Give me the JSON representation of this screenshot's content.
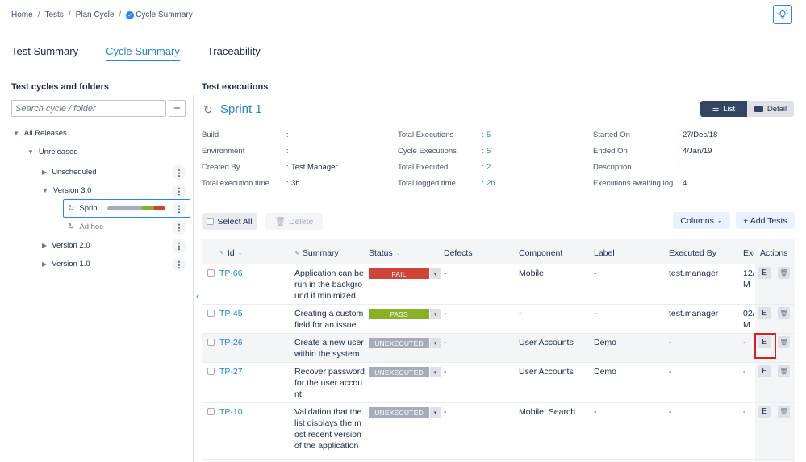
{
  "breadcrumb": [
    "Home",
    "Tests",
    "Plan Cycle",
    "Cycle Summary"
  ],
  "tabs": [
    "Test Summary",
    "Cycle Summary",
    "Traceability"
  ],
  "left": {
    "title": "Test cycles and folders",
    "search_placeholder": "Search cycle / folder",
    "tree": {
      "all_releases": "All Releases",
      "unreleased": "Unreleased",
      "unscheduled": "Unscheduled",
      "version30": "Version 3.0",
      "sprint": "Sprin...",
      "adhoc": "Ad hoc",
      "version20": "Version 2.0",
      "version10": "Version 1.0"
    },
    "progress": {
      "unexecuted": 0.6,
      "pass": 0.2,
      "fail": 0.2
    },
    "colors": {
      "pass": "#8bb026",
      "fail": "#d04437",
      "unexecuted": "#a5adba"
    }
  },
  "right": {
    "title": "Test executions",
    "cycle_name": "Sprint 1",
    "view_list": "List",
    "view_detail": "Detail",
    "meta": {
      "col1": [
        {
          "k": "Build",
          "v": ""
        },
        {
          "k": "Environment",
          "v": ""
        },
        {
          "k": "Created By",
          "v": "Test Manager"
        },
        {
          "k": "Total execution time",
          "v": "3h"
        }
      ],
      "col2": [
        {
          "k": "Total Executions",
          "v": "5"
        },
        {
          "k": "Cycle Executions",
          "v": "5"
        },
        {
          "k": "Total Executed",
          "v": "2"
        },
        {
          "k": "Total logged time",
          "v": "2h"
        }
      ],
      "col3": [
        {
          "k": "Started On",
          "v": "27/Dec/18"
        },
        {
          "k": "Ended On",
          "v": "4/Jan/19"
        },
        {
          "k": "Description",
          "v": ""
        },
        {
          "k": "Executions awaiting log",
          "v": "4"
        }
      ]
    },
    "toolbar": {
      "select_all": "Select All",
      "delete": "Delete",
      "columns": "Columns",
      "add_tests": "+ Add Tests"
    },
    "columns": [
      "Id",
      "Summary",
      "Status",
      "Defects",
      "Component",
      "Label",
      "Executed By",
      "Exe",
      "Actions"
    ],
    "rows": [
      {
        "id": "TP-66",
        "summary": [
          "Application can be",
          "run in the backgro",
          "und if minimized"
        ],
        "status": "FAIL",
        "status_color": "#d04437",
        "defects": "-",
        "component": "Mobile",
        "label": "-",
        "executed_by": "test.manager",
        "exe": [
          "12/",
          "M"
        ]
      },
      {
        "id": "TP-45",
        "summary": [
          "Creating a custom",
          "field for an issue"
        ],
        "status": "PASS",
        "status_color": "#8bb026",
        "defects": "-",
        "component": "-",
        "label": "-",
        "executed_by": "test.manager",
        "exe": [
          "02/",
          "M"
        ]
      },
      {
        "id": "TP-26",
        "summary": [
          "Create a new user",
          "within the system"
        ],
        "status": "UNEXECUTED",
        "status_color": "#a5adba",
        "defects": "-",
        "component": "User Accounts",
        "label": "Demo",
        "executed_by": "-",
        "exe": [
          "-"
        ]
      },
      {
        "id": "TP-27",
        "summary": [
          "Recover password",
          "for the user accou",
          "nt"
        ],
        "status": "UNEXECUTED",
        "status_color": "#a5adba",
        "defects": "-",
        "component": "User Accounts",
        "label": "Demo",
        "executed_by": "-",
        "exe": [
          "-"
        ]
      },
      {
        "id": "TP-10",
        "summary": [
          "Validation that the",
          "list displays the m",
          "ost recent version",
          "of the application"
        ],
        "status": "UNEXECUTED",
        "status_color": "#a5adba",
        "defects": "-",
        "component": "Mobile, Search",
        "label": "-",
        "executed_by": "-",
        "exe": [
          "-"
        ]
      }
    ],
    "action_edit": "E"
  }
}
